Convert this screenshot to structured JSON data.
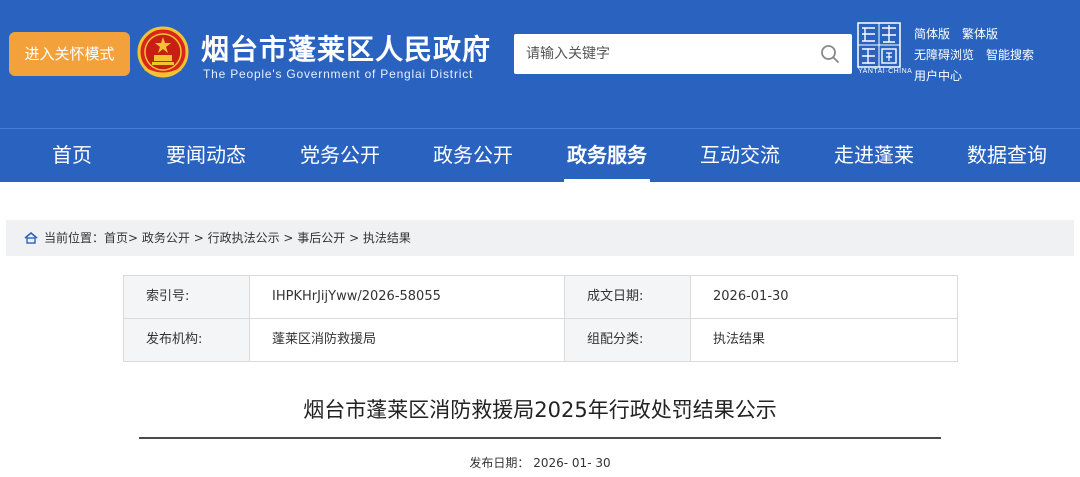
{
  "header": {
    "care_mode_label": "进入关怀模式",
    "site_title": "烟台市蓬莱区人民政府",
    "site_subtitle": "The People's Government of Penglai District",
    "search_placeholder": "请输入关键字",
    "yantai_logo_text": "煙台中國",
    "yantai_logo_en": "YANTAI·CHINA",
    "tools": [
      "简体版",
      "繁体版",
      "无障碍浏览",
      "智能搜索",
      "用户中心"
    ]
  },
  "nav": {
    "items": [
      "首页",
      "要闻动态",
      "党务公开",
      "政务公开",
      "政务服务",
      "互动交流",
      "走进蓬莱",
      "数据查询"
    ],
    "active_label": "政务服务"
  },
  "breadcrumb": {
    "prefix": "当前位置：",
    "path": "首页> 政务公开 > 行政执法公示 > 事后公开 > 执法结果"
  },
  "meta": {
    "index_label": "索引号:",
    "index_value": "IHPKHrJijYww/2026-58055",
    "date_label": "成文日期:",
    "date_value": "2026-01-30",
    "org_label": "发布机构:",
    "org_value": "蓬莱区消防救援局",
    "category_label": "组配分类:",
    "category_value": "执法结果"
  },
  "article": {
    "title": "烟台市蓬莱区消防救援局2025年行政处罚结果公示",
    "publish_label": "发布日期：",
    "publish_date": "2026- 01- 30"
  },
  "colors": {
    "brand_blue": "#2a62c0",
    "care_orange": "#f3a23b"
  }
}
